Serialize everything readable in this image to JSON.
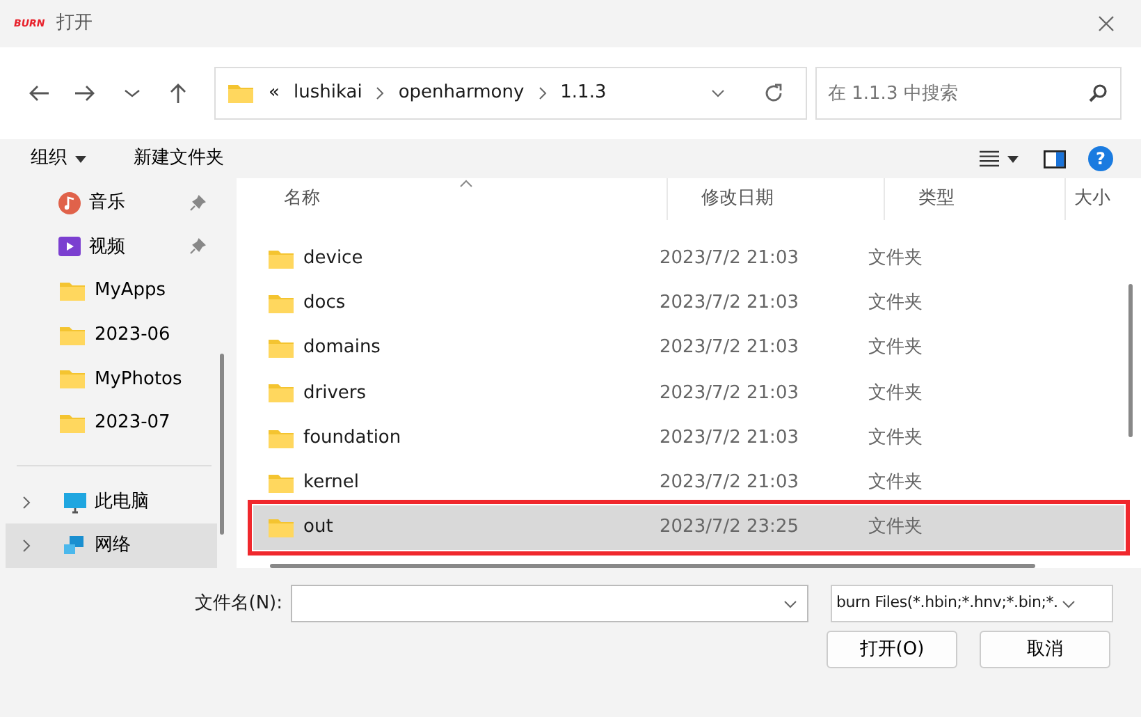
{
  "window": {
    "logo": "BURN",
    "title": "打开"
  },
  "address": {
    "path": [
      {
        "label": "lushikai"
      },
      {
        "label": "openharmony"
      },
      {
        "label": "1.1.3"
      }
    ],
    "overflow": "«"
  },
  "search": {
    "placeholder": "在 1.1.3 中搜索"
  },
  "toolbar": {
    "organize": "组织",
    "new_folder": "新建文件夹",
    "help": "?"
  },
  "sidebar": {
    "items": [
      {
        "label": "音乐",
        "kind": "music",
        "pinned": true,
        "selected": false
      },
      {
        "label": "视频",
        "kind": "video",
        "pinned": true,
        "selected": false
      },
      {
        "label": "MyApps",
        "kind": "folder",
        "pinned": false,
        "selected": false
      },
      {
        "label": "2023-06",
        "kind": "folder",
        "pinned": false,
        "selected": false
      },
      {
        "label": "MyPhotos",
        "kind": "folder",
        "pinned": false,
        "selected": false
      },
      {
        "label": "2023-07",
        "kind": "folder",
        "pinned": false,
        "selected": false
      },
      {
        "label": "此电脑",
        "kind": "pc",
        "pinned": false,
        "selected": false
      },
      {
        "label": "网络",
        "kind": "network",
        "pinned": false,
        "selected": true
      }
    ]
  },
  "table": {
    "columns": [
      "名称",
      "修改日期",
      "类型",
      "大小"
    ],
    "rows": [
      {
        "name": "device",
        "modified": "2023/7/2 21:03",
        "type": "文件夹",
        "selected": false,
        "highlighted": false
      },
      {
        "name": "docs",
        "modified": "2023/7/2 21:03",
        "type": "文件夹",
        "selected": false,
        "highlighted": false
      },
      {
        "name": "domains",
        "modified": "2023/7/2 21:03",
        "type": "文件夹",
        "selected": false,
        "highlighted": false
      },
      {
        "name": "drivers",
        "modified": "2023/7/2 21:03",
        "type": "文件夹",
        "selected": false,
        "highlighted": false
      },
      {
        "name": "foundation",
        "modified": "2023/7/2 21:03",
        "type": "文件夹",
        "selected": false,
        "highlighted": false
      },
      {
        "name": "kernel",
        "modified": "2023/7/2 21:03",
        "type": "文件夹",
        "selected": false,
        "highlighted": false
      },
      {
        "name": "out",
        "modified": "2023/7/2 23:25",
        "type": "文件夹",
        "selected": true,
        "highlighted": true
      }
    ]
  },
  "footer": {
    "filename_label": "文件名(N):",
    "filter": "burn Files(*.hbin;*.hnv;*.bin;*.",
    "buttons": [
      "打开(O)",
      "取消"
    ]
  }
}
